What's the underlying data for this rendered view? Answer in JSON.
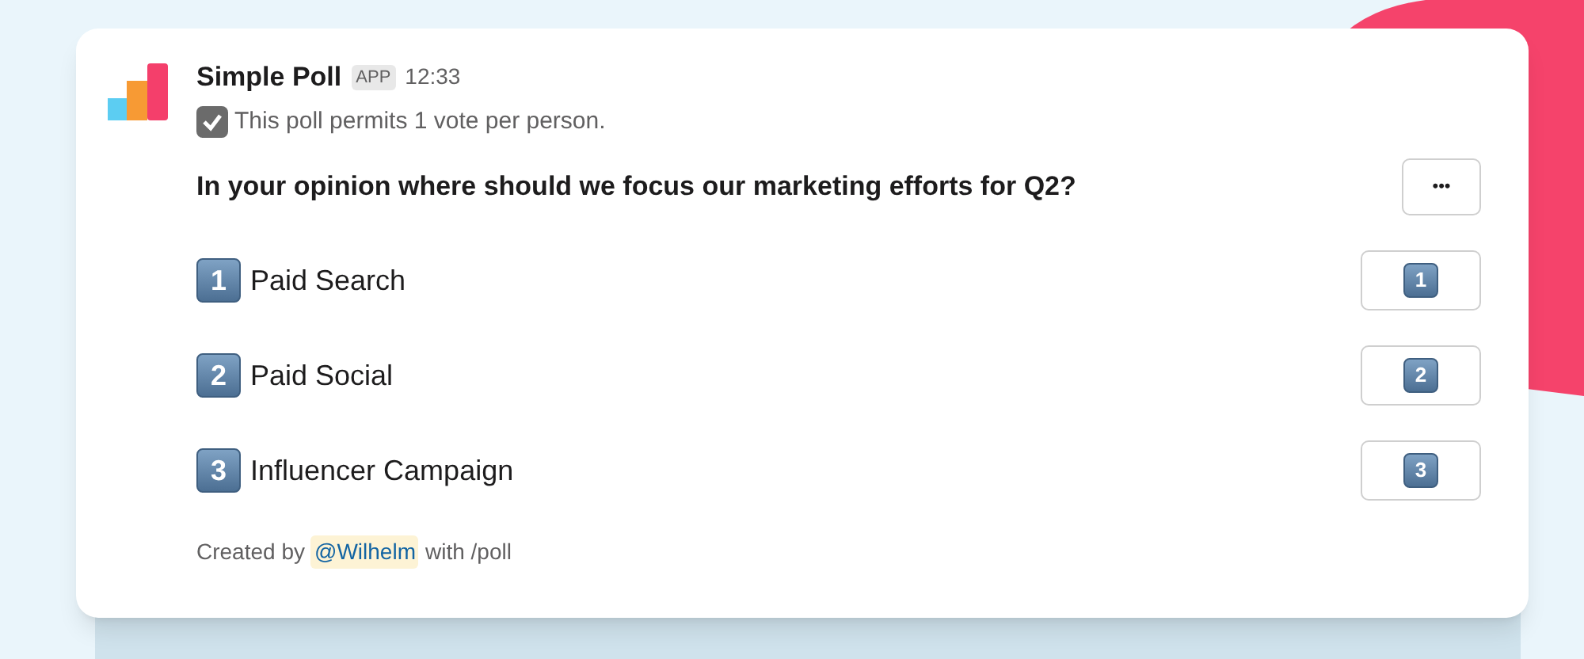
{
  "message": {
    "sender": "Simple Poll",
    "badge": "APP",
    "time": "12:33",
    "notice": {
      "checked": true,
      "text": "This poll permits 1 vote per person."
    },
    "question": "In your opinion where should we focus our marketing efforts for Q2?",
    "menu_button": "•••",
    "options": [
      {
        "number": "1",
        "label": "Paid Search",
        "vote_button": "1"
      },
      {
        "number": "2",
        "label": "Paid Social",
        "vote_button": "2"
      },
      {
        "number": "3",
        "label": "Influencer Campaign",
        "vote_button": "3"
      }
    ],
    "footer": {
      "prefix": "Created by",
      "mention": "@Wilhelm",
      "suffix": "with /poll"
    }
  }
}
